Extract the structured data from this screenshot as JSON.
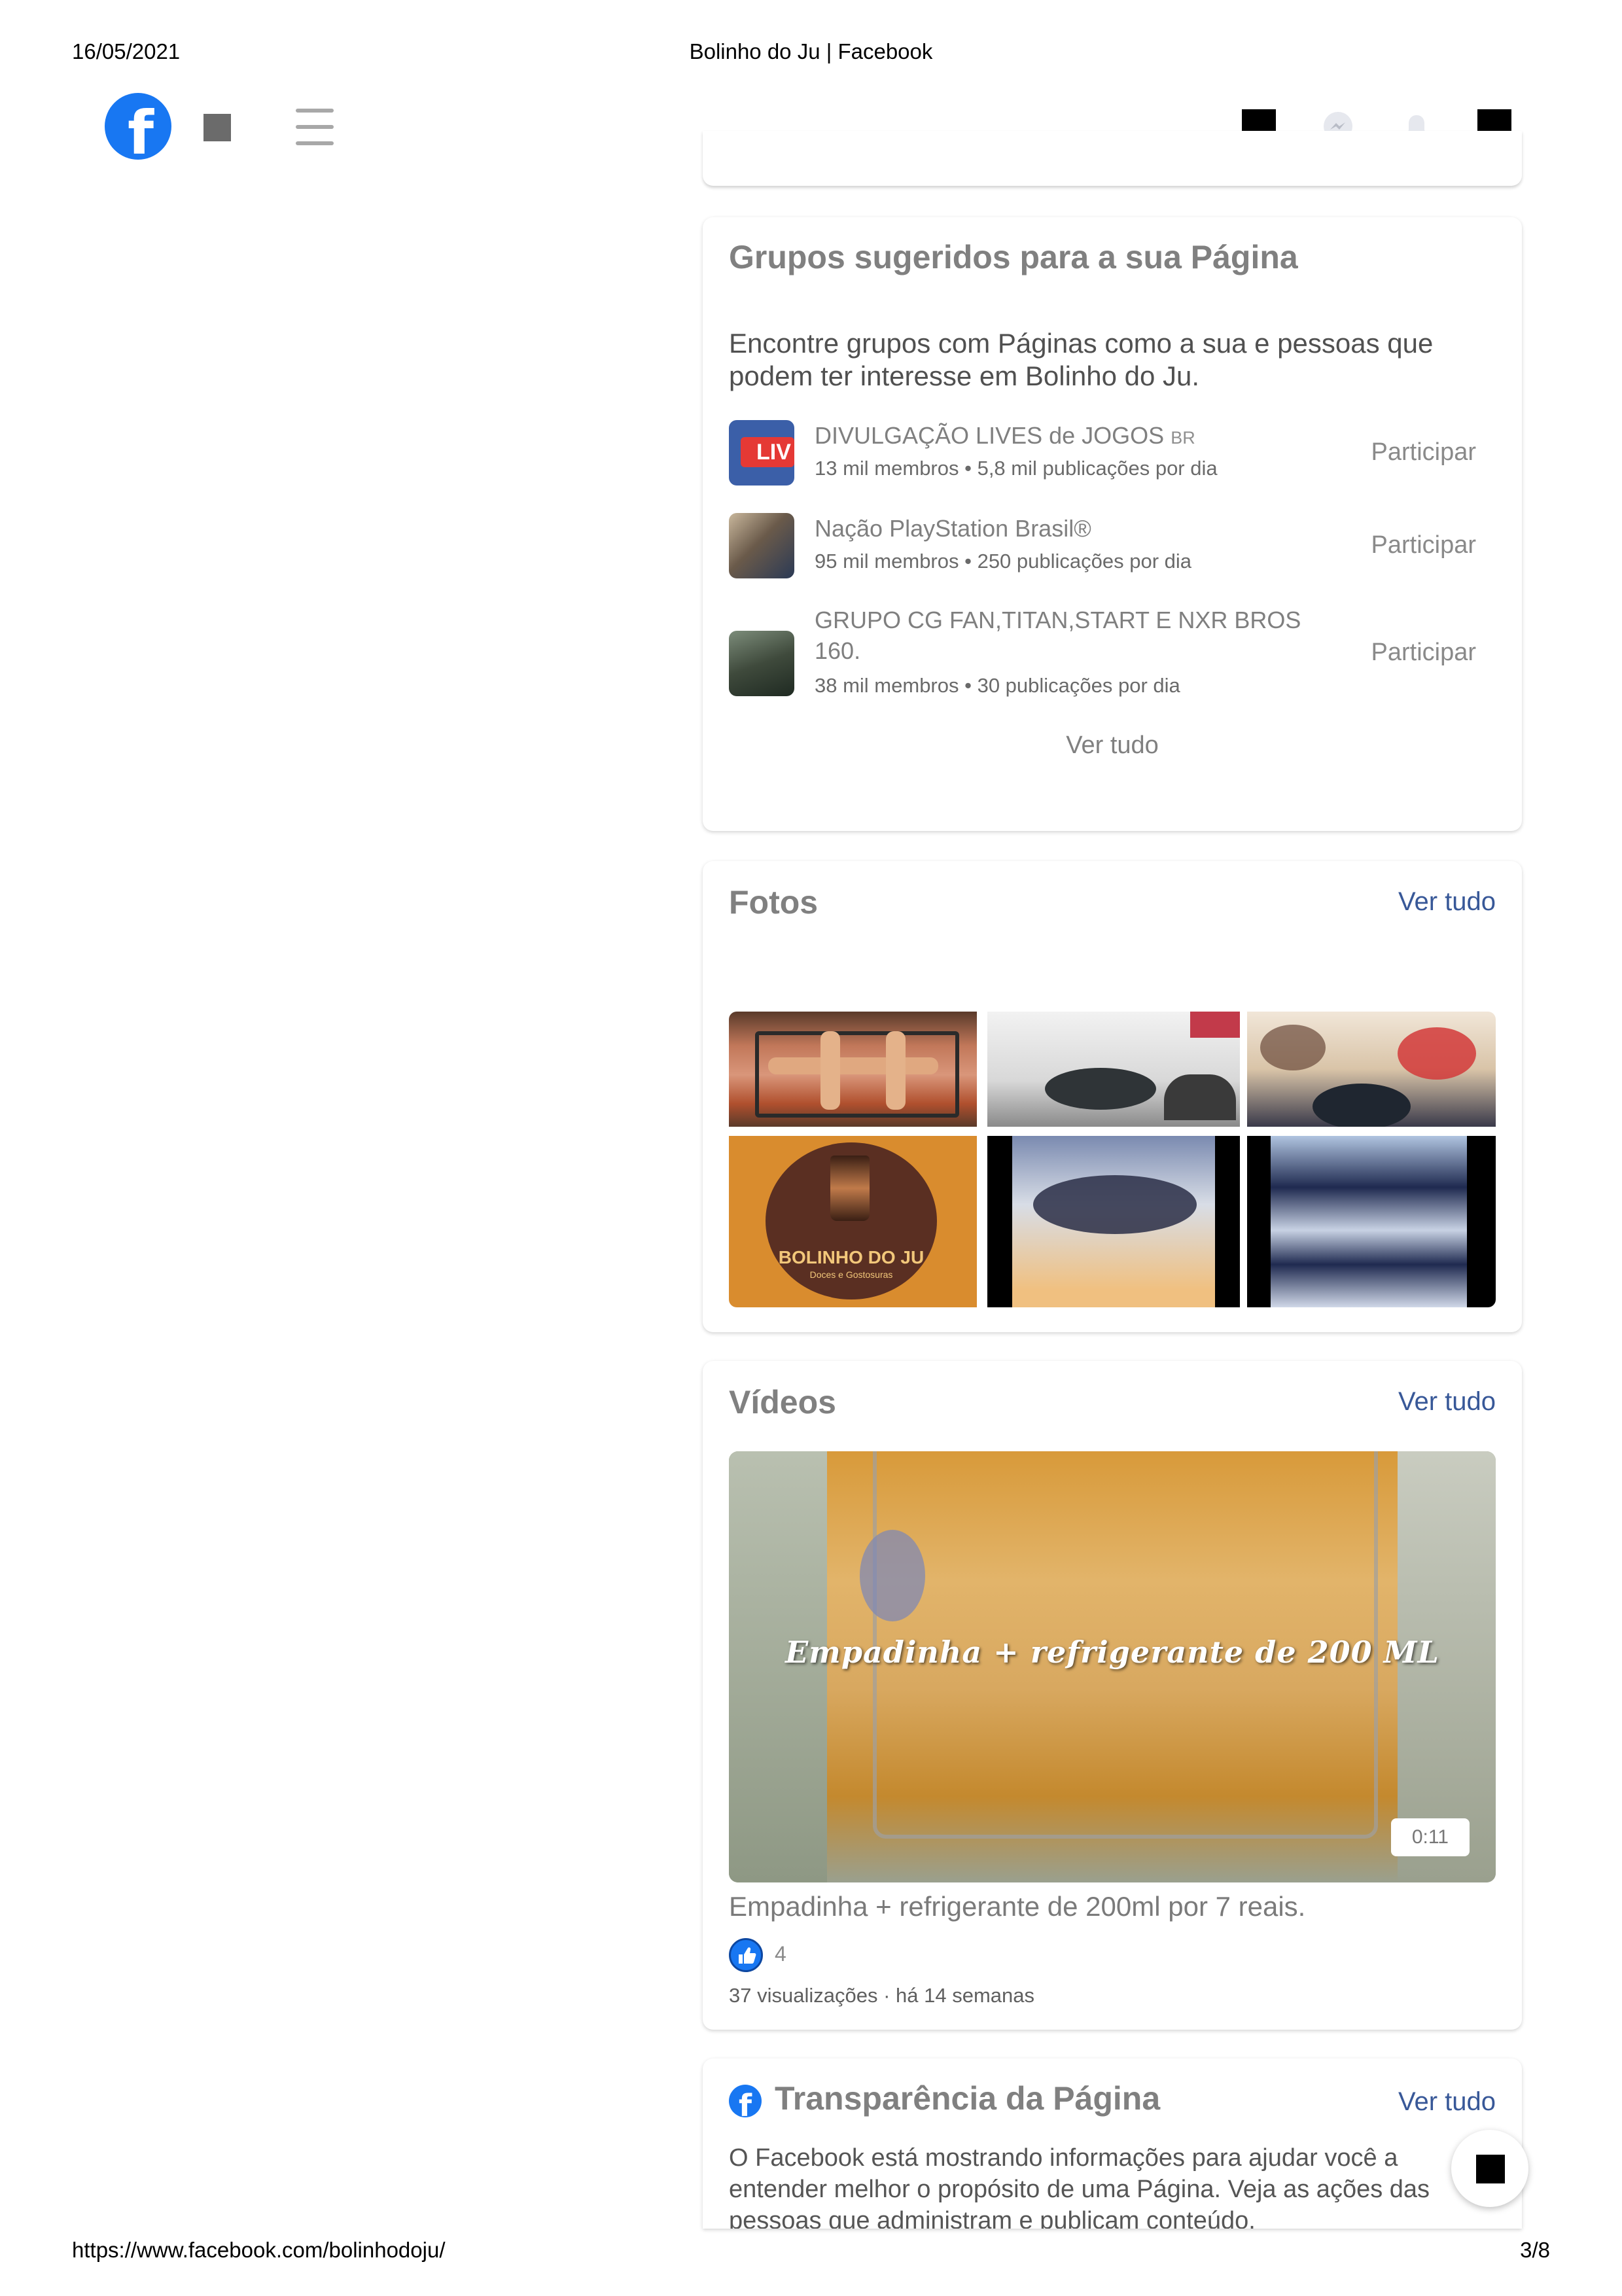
{
  "print_header": {
    "date": "16/05/2021",
    "title": "Bolinho do Ju | Facebook"
  },
  "print_footer": {
    "url": "https://www.facebook.com/bolinhodoju/",
    "page": "3/8"
  },
  "nav": {
    "logo_letter": "f",
    "icons": [
      "facebook-logo",
      "square-icon",
      "menu-icon",
      "square-icon",
      "messenger-icon",
      "bell-icon",
      "square-icon"
    ]
  },
  "groups_card": {
    "title": "Grupos sugeridos para a sua Página",
    "description": "Encontre grupos com Páginas como a sua e pessoas que podem ter interesse em Bolinho do Ju.",
    "groups": [
      {
        "name": "DIVULGAÇÃO LIVES de JOGOS",
        "tag": "BR",
        "meta": "13 mil membros • 5,8 mil publicações por dia",
        "join": "Participar",
        "thumb_text": "LIV"
      },
      {
        "name": "Nação PlayStation Brasil®",
        "tag": "",
        "meta": "95 mil membros • 250 publicações por dia",
        "join": "Participar"
      },
      {
        "name": "GRUPO CG FAN,TITAN,START E NXR BROS 160.",
        "tag": "",
        "meta": "38 mil membros • 30 publicações por dia",
        "join": "Participar"
      }
    ],
    "see_all": "Ver tudo"
  },
  "photos_card": {
    "title": "Fotos",
    "see_all": "Ver tudo",
    "logo_text": "BOLINHO DO JU",
    "logo_subtext": "Doces e Gostosuras"
  },
  "videos_card": {
    "title": "Vídeos",
    "see_all": "Ver tudo",
    "overlay_text": "Empadinha + refrigerante de 200 ML",
    "duration": "0:11",
    "video_title": "Empadinha + refrigerante de 200ml por 7 reais.",
    "likes": "4",
    "meta": "37 visualizações · há 14 semanas"
  },
  "transparency_card": {
    "title": "Transparência da Página",
    "see_all": "Ver tudo",
    "text": "O Facebook está mostrando informações para ajudar você a entender melhor o propósito de uma Página. Veja as ações das pessoas que administram e publicam conteúdo."
  }
}
